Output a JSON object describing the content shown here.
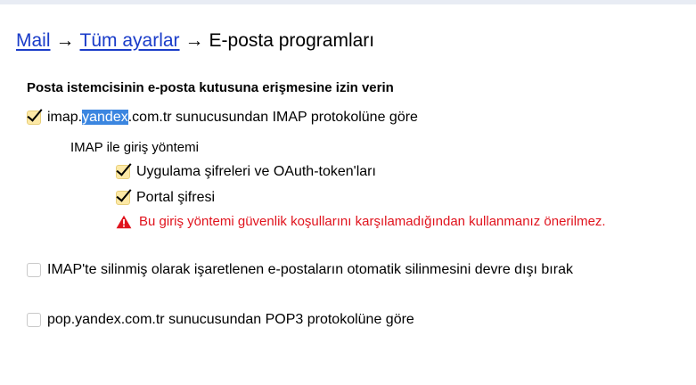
{
  "breadcrumb": {
    "mail": "Mail",
    "separator": "→",
    "all_settings": "Tüm ayarlar",
    "current": "E-posta programları"
  },
  "section_title": "Posta istemcisinin e-posta kutusuna erişmesine izin verin",
  "imap": {
    "checked": true,
    "label_before": "imap.",
    "label_selected": "yandex",
    "label_after": ".com.tr sunucusundan IMAP protokolüne göre"
  },
  "login_methods": {
    "title": "IMAP ile giriş yöntemi",
    "app_passwords": {
      "checked": true,
      "label": "Uygulama şifreleri ve OAuth-token'ları"
    },
    "portal_password": {
      "checked": true,
      "label": "Portal şifresi"
    },
    "warning_icon": "warning-triangle-icon",
    "warning_text": "Bu giriş yöntemi güvenlik koşullarını karşılamadığından kullanmanız önerilmez."
  },
  "auto_expunge": {
    "checked": false,
    "label": "IMAP'te silinmiş olarak işaretlenen e-postaların otomatik silinmesini devre dışı bırak"
  },
  "pop3": {
    "checked": false,
    "label": "pop.yandex.com.tr sunucusundan POP3 protokolüne göre"
  },
  "colors": {
    "link": "#1a3cc9",
    "warning": "#e0131d",
    "checkbox_checked_bg": "#fde9a6",
    "selection": "#3b86e0"
  }
}
